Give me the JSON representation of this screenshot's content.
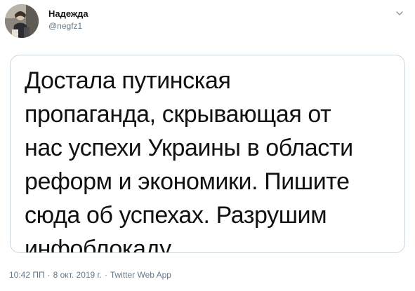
{
  "author": {
    "display_name": "Надежда",
    "handle": "@negfz1",
    "avatar_icon": "user-photo-icon"
  },
  "menu": {
    "icon": "chevron-down-icon"
  },
  "media": {
    "lines": [
      "Достала путинская",
      "пропаганда, скрывающая от",
      "нас успехи Украины в области",
      "реформ и экономики. Пишите",
      "сюда об успехах. Разрушим",
      "инфоблокаду"
    ]
  },
  "meta": {
    "time": "10:42 ПП",
    "separator": "·",
    "date": "8 окт. 2019 г.",
    "source": "Twitter Web App"
  },
  "colors": {
    "text_primary": "#14171a",
    "text_secondary": "#657786",
    "border": "#ccd6dd"
  }
}
